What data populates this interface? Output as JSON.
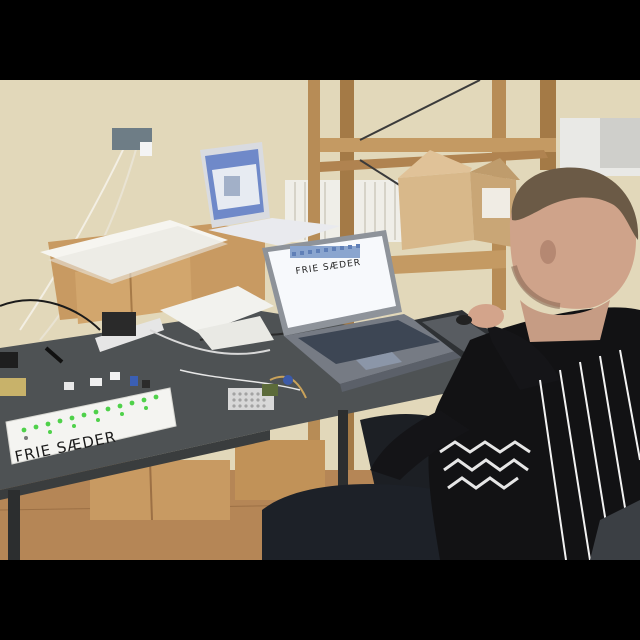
{
  "image": {
    "sign_text": "FRIE SÆDER",
    "laptop_screen_text": "FRIE SÆDER",
    "colors": {
      "wall": "#e9e1c9",
      "floor": "#b98c5c",
      "desk": "#4d5152",
      "shirt": "#121212",
      "led": "#4fd14a"
    }
  }
}
